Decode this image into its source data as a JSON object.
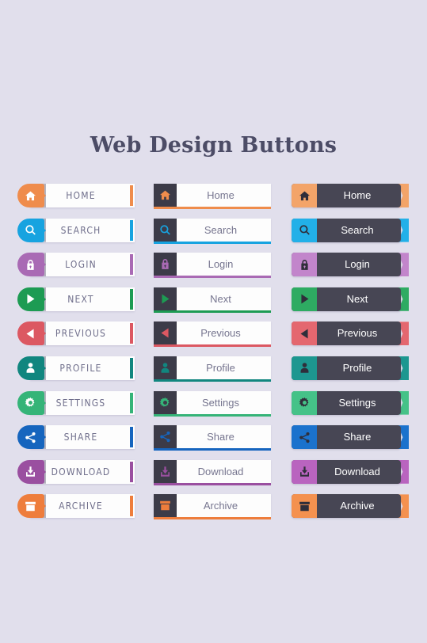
{
  "page": {
    "title": "Web Design Buttons",
    "background_color": "#e1dfec",
    "title_color": "#4c4c66"
  },
  "styles": {
    "column_1": {
      "name": "rounded-badge-light",
      "body_color": "#fdfdfd",
      "label_color": "#6f6e8b",
      "label_case": "uppercase"
    },
    "column_2": {
      "name": "dark-iconbox-underline",
      "body_color": "#fdfdfd",
      "iconbox_color": "#3c3b48",
      "label_color": "#76758f"
    },
    "column_3": {
      "name": "dark-body-ribbon",
      "body_color": "#474654",
      "label_color": "#ffffff",
      "icon_glyph_color": "#2f2e3a"
    }
  },
  "buttons": [
    {
      "id": "home",
      "icon": "home-icon",
      "label_upper": "HOME",
      "label": "Home",
      "color": "#ef8c4c",
      "color_light": "#f3a469"
    },
    {
      "id": "search",
      "icon": "search-icon",
      "label_upper": "SEARCH",
      "label": "Search",
      "color": "#17a3e0",
      "color_light": "#22b0e8"
    },
    {
      "id": "login",
      "icon": "lock-icon",
      "label_upper": "LOGIN",
      "label": "Login",
      "color": "#a96ab4",
      "color_light": "#c285cb"
    },
    {
      "id": "next",
      "icon": "play-right-icon",
      "label_upper": "NEXT",
      "label": "Next",
      "color": "#1d9b53",
      "color_light": "#2eab62"
    },
    {
      "id": "previous",
      "icon": "play-left-icon",
      "label_upper": "PREVIOUS",
      "label": "Previous",
      "color": "#dc5862",
      "color_light": "#e4676f"
    },
    {
      "id": "profile",
      "icon": "user-icon",
      "label_upper": "PROFILE",
      "label": "Profile",
      "color": "#11867f",
      "color_light": "#1d9790"
    },
    {
      "id": "settings",
      "icon": "gear-icon",
      "label_upper": "SETTINGS",
      "label": "Settings",
      "color": "#35b478",
      "color_light": "#45c288"
    },
    {
      "id": "share",
      "icon": "share-icon",
      "label_upper": "SHARE",
      "label": "Share",
      "color": "#1665be",
      "color_light": "#1b72cd"
    },
    {
      "id": "download",
      "icon": "download-icon",
      "label_upper": "DOWNLOAD",
      "label": "Download",
      "color": "#9a4fa0",
      "color_light": "#b964bf"
    },
    {
      "id": "archive",
      "icon": "archive-icon",
      "label_upper": "ARCHIVE",
      "label": "Archive",
      "color": "#ee7d3c",
      "color_light": "#f4914f"
    }
  ]
}
